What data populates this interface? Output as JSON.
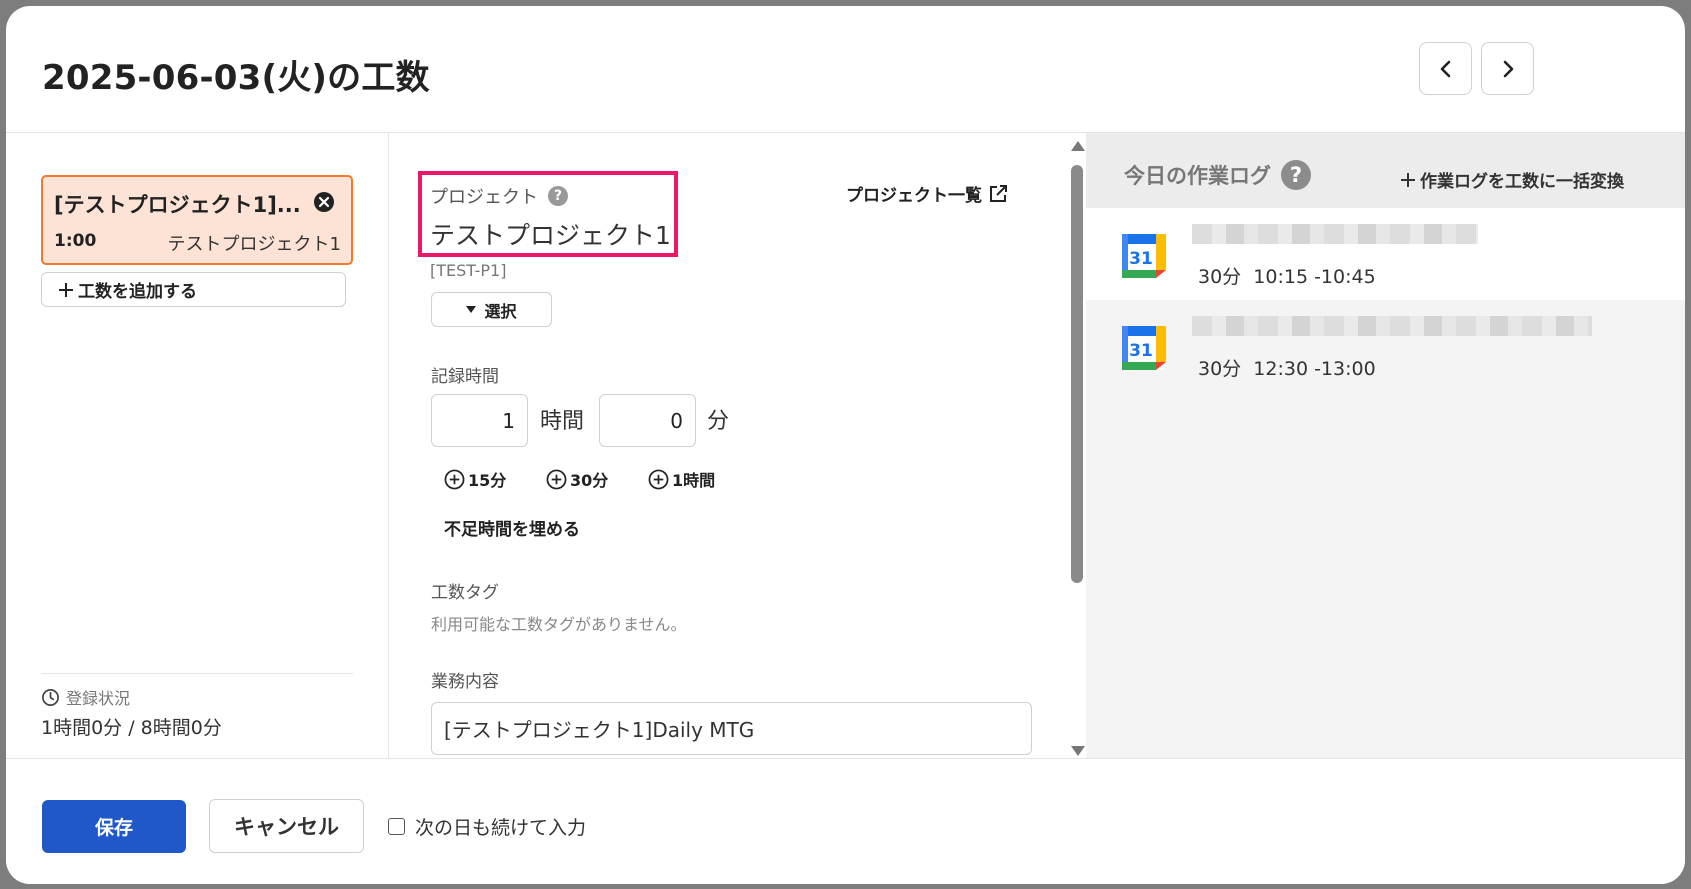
{
  "header": {
    "title": "2025-06-03(火)の工数",
    "prev_icon": "chevron-left-icon",
    "next_icon": "chevron-right-icon"
  },
  "left": {
    "entry": {
      "title": "[テストプロジェクト1]...",
      "time": "1:00",
      "project": "テストプロジェクト1"
    },
    "add_label": "工数を追加する",
    "status_label": "登録状況",
    "status_value": "1時間0分 / 8時間0分"
  },
  "form": {
    "project_label": "プロジェクト",
    "project_value": "テストプロジェクト1",
    "project_code": "[TEST-P1]",
    "select_label": "選択",
    "project_list_label": "プロジェクト一覧",
    "record_label": "記録時間",
    "hours_value": "1",
    "hours_unit": "時間",
    "minutes_value": "0",
    "minutes_unit": "分",
    "quick_15": "15分",
    "quick_30": "30分",
    "quick_60": "1時間",
    "fill_label": "不足時間を埋める",
    "tag_label": "工数タグ",
    "tag_empty": "利用可能な工数タグがありません。",
    "work_label": "業務内容",
    "work_value": "[テストプロジェクト1]Daily MTG"
  },
  "worklog": {
    "title": "今日の作業ログ",
    "convert_label": "作業ログを工数に一括変換",
    "items": [
      {
        "icon": "google-calendar-icon",
        "day": "31",
        "duration": "30分",
        "range": "10:15 -10:45"
      },
      {
        "icon": "google-calendar-icon",
        "day": "31",
        "duration": "30分",
        "range": "12:30 -13:00"
      }
    ]
  },
  "footer": {
    "save_label": "保存",
    "cancel_label": "キャンセル",
    "continue_label": "次の日も続けて入力"
  },
  "colors": {
    "primary": "#2057c9",
    "entry_bg": "#fde2d6",
    "entry_border": "#f07a2d",
    "highlight": "#ec1768"
  }
}
